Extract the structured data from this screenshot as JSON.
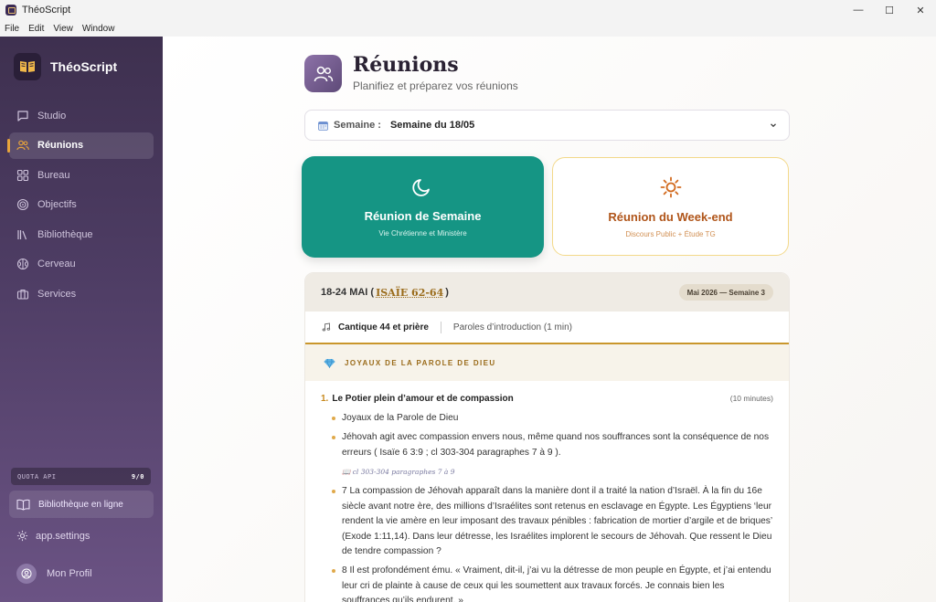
{
  "window": {
    "title": "ThéoScript",
    "menu": [
      "File",
      "Edit",
      "View",
      "Window"
    ]
  },
  "sidebar": {
    "brand": "ThéoScript",
    "items": [
      {
        "label": "Studio",
        "icon": "chat-bubble-icon"
      },
      {
        "label": "Réunions",
        "icon": "users-icon",
        "active": true
      },
      {
        "label": "Bureau",
        "icon": "grid-icon"
      },
      {
        "label": "Objectifs",
        "icon": "target-icon"
      },
      {
        "label": "Bibliothèque",
        "icon": "library-icon"
      },
      {
        "label": "Cerveau",
        "icon": "brain-icon"
      },
      {
        "label": "Services",
        "icon": "briefcase-icon"
      }
    ],
    "quota_label": "QUOTA API",
    "quota_value": "9/0",
    "online_library": "Bibliothèque en ligne",
    "settings": "app.settings",
    "profile": "Mon Profil"
  },
  "page": {
    "title": "Réunions",
    "subtitle": "Planifiez et préparez vos réunions"
  },
  "week_selector": {
    "label": "Semaine :",
    "value": "Semaine du 18/05"
  },
  "cards": {
    "week": {
      "title": "Réunion de Semaine",
      "subtitle": "Vie Chrétienne et Ministère"
    },
    "weekend": {
      "title": "Réunion du Week-end",
      "subtitle": "Discours Public + Étude TG"
    }
  },
  "program": {
    "dates": "18-24 MAI (",
    "reading": "ISAÏE 62-64",
    "close_paren": ")",
    "badge": "Mai 2026 — Semaine 3",
    "song": "Cantique 44 et prière",
    "intro": "Paroles d’introduction (1 min)",
    "section": "JOYAUX DE LA PAROLE DE DIEU",
    "part": {
      "number": "1.",
      "title": "Le Potier plein d’amour et de compassion",
      "duration": "(10 minutes)",
      "points": [
        "Joyaux de la Parole de Dieu",
        "Jéhovah agit avec compassion envers nous, même quand nos souffrances sont la conséquence de nos erreurs ( Isaïe 6 3:9 ; cl 303-304 paragraphes 7 à 9 ).",
        "cl 303-304 paragraphes 7 à 9",
        "7 La compassion de Jéhovah apparaît dans la manière dont il a traité la nation d’Israël. À la fin du 16e siècle avant notre ère, des millions d’Israélites sont retenus en esclavage en Égypte. Les Égyptiens ‘leur rendent la vie amère en leur imposant des travaux pénibles : fabrication de mortier d’argile et de briques’ (Exode 1:11,14). Dans leur détresse, les Israélites implorent le secours de Jéhovah. Que ressent le Dieu de tendre compassion ?",
        "8 Il est profondément ému. « Vraiment, dit-il, j’ai vu la détresse de mon peuple en Égypte, et j’ai entendu leur cri de plainte à cause de ceux qui les soumettent aux travaux forcés. Je connais bien les souffrances qu’ils endurent. »"
      ]
    }
  }
}
